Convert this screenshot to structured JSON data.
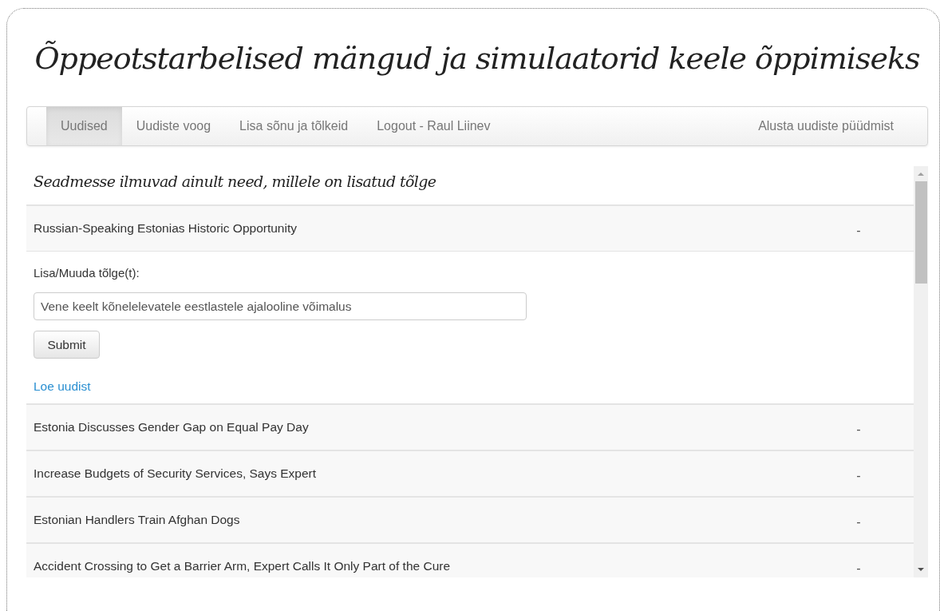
{
  "title": "Õppeotstarbelised mängud ja simulaatorid keele õppimiseks",
  "nav": {
    "items": [
      {
        "label": "Uudised",
        "selected": true
      },
      {
        "label": "Uudiste voog",
        "selected": false
      },
      {
        "label": "Lisa sõnu ja tõlkeid",
        "selected": false
      },
      {
        "label": "Logout - Raul Liinev",
        "selected": false
      }
    ],
    "right_item": "Alusta uudiste püüdmist"
  },
  "notice": "Seadmesse ilmuvad ainult need, millele on lisatud tõlge",
  "news": [
    {
      "headline": "Russian-Speaking Estonias Historic Opportunity",
      "status": "-",
      "form": {
        "label": "Lisa/Muuda tõlge(t):",
        "value": "Vene keelt kõnelelevatele eestlastele ajalooline võimalus",
        "submit": "Submit",
        "link": "Loe uudist"
      }
    },
    {
      "headline": "Estonia Discusses Gender Gap on Equal Pay Day",
      "status": "-"
    },
    {
      "headline": "Increase Budgets of Security Services, Says Expert",
      "status": "-"
    },
    {
      "headline": "Estonian Handlers Train Afghan Dogs",
      "status": "-"
    },
    {
      "headline": "Accident Crossing to Get a Barrier Arm, Expert Calls It Only Part of the Cure",
      "status": "-"
    }
  ]
}
